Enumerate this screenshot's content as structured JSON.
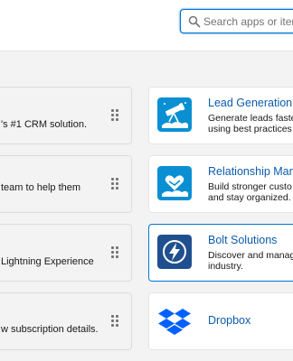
{
  "search": {
    "placeholder": "Search apps or items..."
  },
  "left_cards": [
    {
      "description": "'s #1 CRM solution."
    },
    {
      "description": "team to help them"
    },
    {
      "description": "Lightning Experience"
    },
    {
      "description": "w subscription details."
    }
  ],
  "right_cards": [
    {
      "title": "Lead Generation",
      "line1": "Generate leads faste",
      "line2": "using best practices",
      "icon": "telescope-icon",
      "color": "#0b8fd3"
    },
    {
      "title": "Relationship Man",
      "line1": "Build stronger custo",
      "line2": "and stay organized.",
      "icon": "heart-handshake-icon",
      "color": "#0b8fd3"
    },
    {
      "title": "Bolt Solutions",
      "line1": "Discover and manag",
      "line2": "industry.",
      "icon": "bolt-icon",
      "color": "#1f4f8f"
    },
    {
      "title": "Dropbox",
      "line1": "",
      "line2": "",
      "icon": "dropbox-icon",
      "color": "#0061fe"
    }
  ]
}
